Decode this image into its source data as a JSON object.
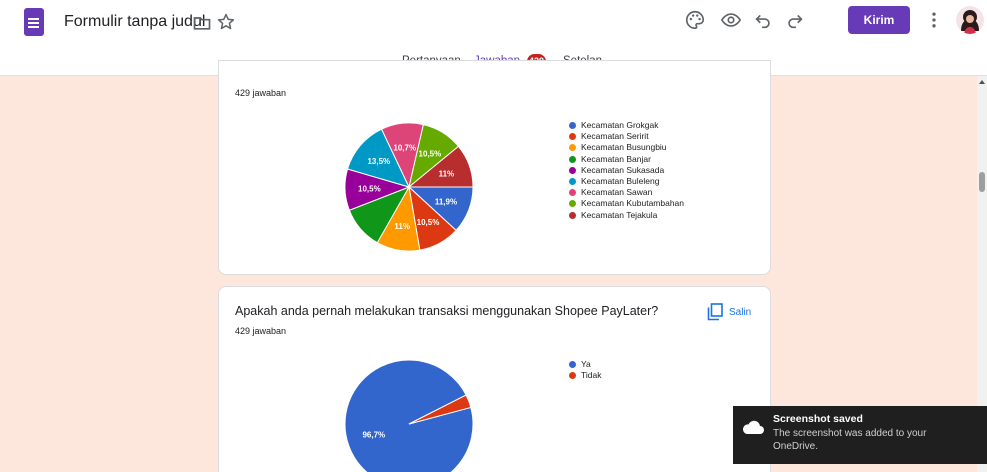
{
  "header": {
    "form_title": "Formulir tanpa judul",
    "send_label": "Kirim",
    "icons": [
      "forms-app-icon",
      "folder-icon",
      "star-icon",
      "palette-icon",
      "preview-eye-icon",
      "undo-icon",
      "redo-icon",
      "more-vert-icon",
      "avatar"
    ]
  },
  "tabs": {
    "questions": "Pertanyaan",
    "responses": "Jawaban",
    "responses_count": "429",
    "settings": "Setelan"
  },
  "cards": [
    {
      "response_count": "429 jawaban",
      "chart_data": {
        "type": "pie",
        "legend_placement": "right",
        "slices": [
          {
            "name": "Kecamatan Grokgak",
            "value": 11.9,
            "label": "11,9%",
            "color": "#3366cc"
          },
          {
            "name": "Kecamatan Seririt",
            "value": 10.5,
            "label": "10,5%",
            "color": "#dc3912"
          },
          {
            "name": "Kecamatan Busungbiu",
            "value": 11.0,
            "label": "11%",
            "color": "#ff9900"
          },
          {
            "name": "Kecamatan Banjar",
            "value": 10.9,
            "label": "",
            "color": "#109618"
          },
          {
            "name": "Kecamatan Sukasada",
            "value": 10.5,
            "label": "10,5%",
            "color": "#990099"
          },
          {
            "name": "Kecamatan Buleleng",
            "value": 13.5,
            "label": "13,5%",
            "color": "#0099c6"
          },
          {
            "name": "Kecamatan Sawan",
            "value": 10.7,
            "label": "10,7%",
            "color": "#dd4477"
          },
          {
            "name": "Kecamatan Kubutambahan",
            "value": 10.5,
            "label": "10,5%",
            "color": "#66aa00"
          },
          {
            "name": "Kecamatan Tejakula",
            "value": 11.0,
            "label": "11%",
            "color": "#b82e2e"
          }
        ]
      }
    },
    {
      "question": "Apakah anda pernah melakukan transaksi menggunakan Shopee PayLater?",
      "response_count": "429 jawaban",
      "copy_label": "Salin",
      "chart_data": {
        "type": "pie",
        "legend_placement": "right",
        "slices": [
          {
            "name": "Ya",
            "value": 96.7,
            "label": "96,7%",
            "color": "#3366cc"
          },
          {
            "name": "Tidak",
            "value": 3.3,
            "label": "",
            "color": "#dc3912"
          }
        ]
      }
    }
  ],
  "toast": {
    "title": "Screenshot saved",
    "body": "The screenshot was added to your OneDrive."
  }
}
